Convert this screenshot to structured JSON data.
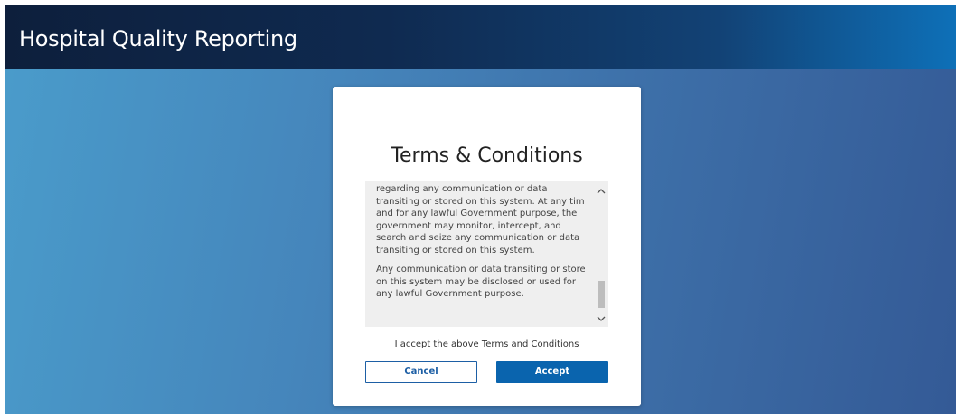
{
  "header": {
    "title": "Hospital Quality Reporting"
  },
  "modal": {
    "title": "Terms & Conditions",
    "terms_paragraphs": [
      "regarding any communication or data transiting or stored on this system. At any time, and for any lawful Government purpose, the government may monitor, intercept, and search and seize any communication or data transiting or stored on this system.",
      "Any communication or data transiting or stored on this system may be disclosed or used for any lawful Government purpose."
    ],
    "accept_label": "I accept the above Terms and Conditions",
    "cancel_label": "Cancel",
    "accept_button_label": "Accept"
  },
  "icons": {
    "scroll_up": "chevron-up-icon",
    "scroll_down": "chevron-down-icon"
  },
  "colors": {
    "header_dark": "#0f2a50",
    "header_light": "#0e70b8",
    "primary_button": "#0a64ae",
    "terms_background": "#efefef"
  }
}
